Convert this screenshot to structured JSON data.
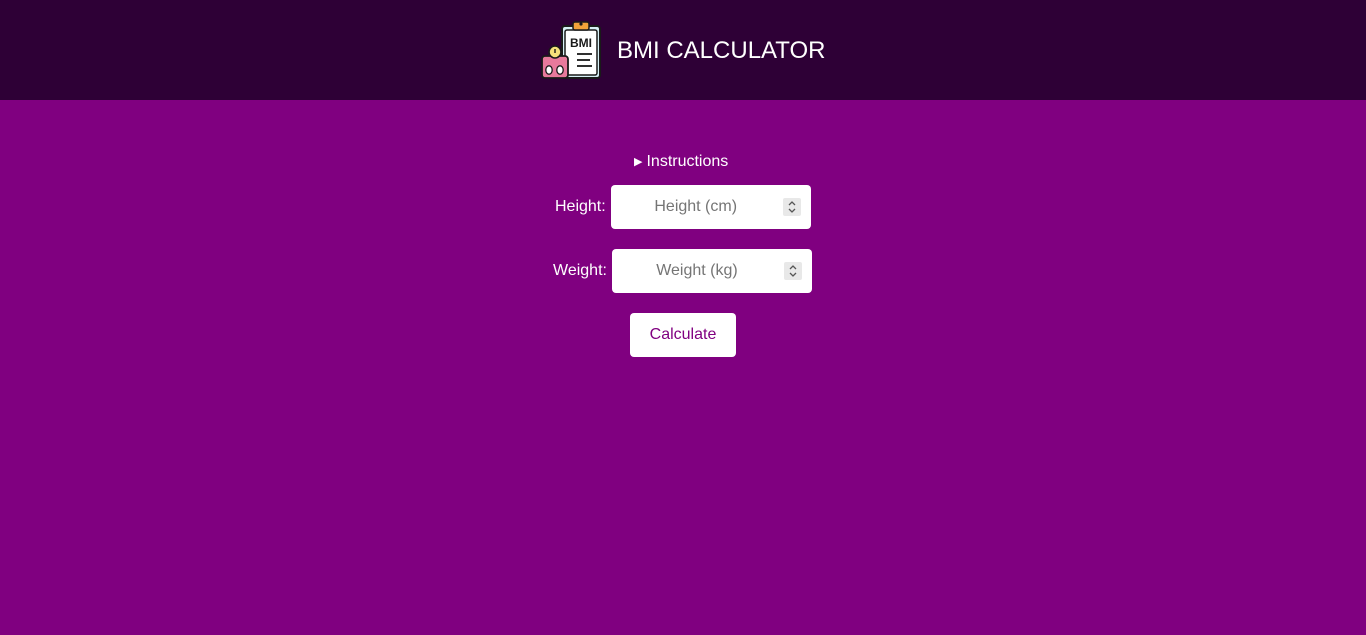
{
  "header": {
    "title": "BMI CALCULATOR",
    "logo_icon": "bmi-clipboard-icon",
    "background": "#2e0036"
  },
  "theme": {
    "background": "#800080",
    "accent": "#800080"
  },
  "instructions": {
    "label": "Instructions",
    "caret_icon": "triangle-right-icon"
  },
  "form": {
    "height": {
      "label": "Height:",
      "placeholder": "Height (cm)",
      "value": ""
    },
    "weight": {
      "label": "Weight:",
      "placeholder": "Weight (kg)",
      "value": ""
    },
    "calculate_label": "Calculate"
  }
}
